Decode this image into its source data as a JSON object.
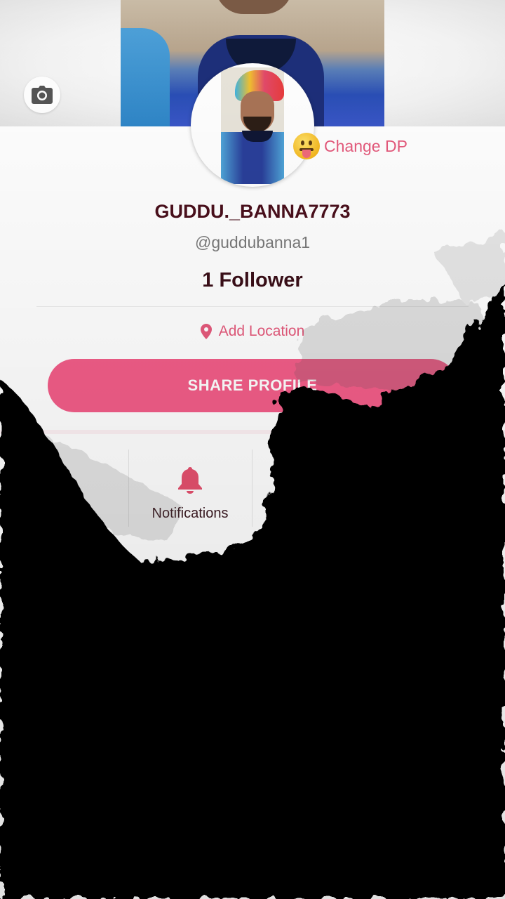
{
  "profile": {
    "username": "GUDDU._BANNA7773",
    "handle": "@guddubanna1",
    "followers": "1 Follower",
    "location_label": "Add Location",
    "change_dp_label": "Change DP",
    "share_label": "SHARE PROFILE"
  },
  "quick_actions": {
    "notifications_label": "Notifications"
  },
  "icons": {
    "camera": "camera-icon",
    "location": "location-pin-icon",
    "bell": "bell-icon",
    "emoji": "tongue-emoji-icon"
  },
  "colors": {
    "accent": "#f25d88",
    "accent_text": "#e55a7c",
    "title": "#4a0f1c"
  }
}
